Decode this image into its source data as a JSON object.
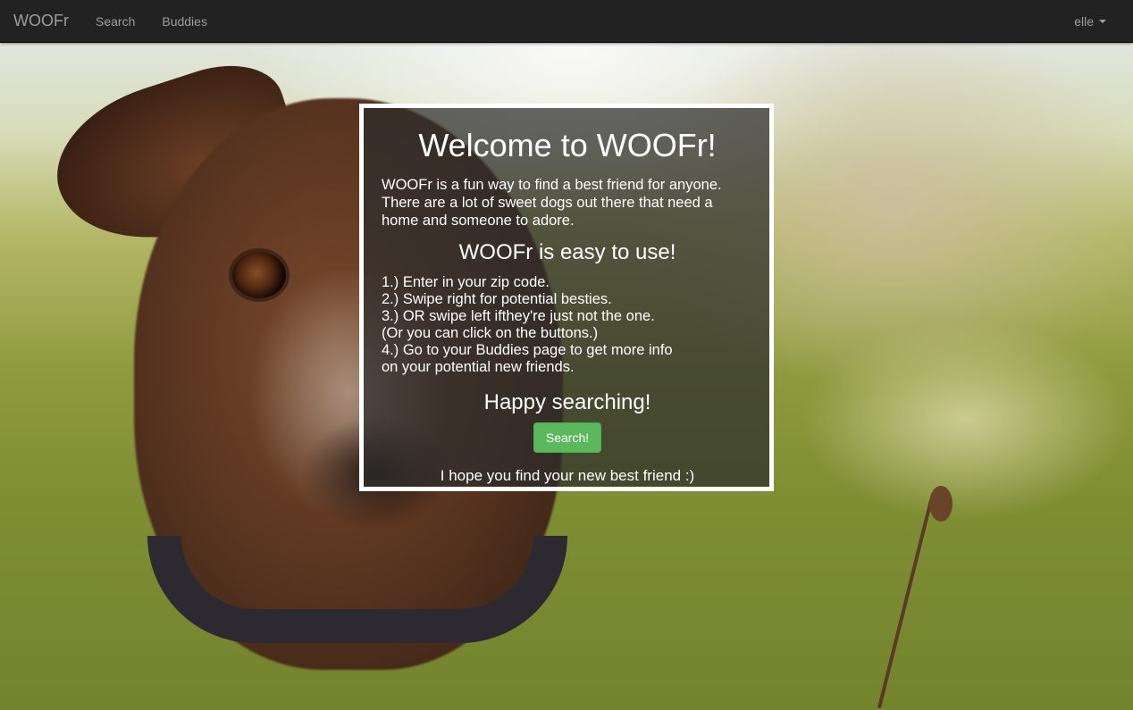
{
  "navbar": {
    "brand": "WOOFr",
    "links": [
      "Search",
      "Buddies"
    ],
    "user": "elle"
  },
  "welcome": {
    "title": "Welcome to WOOFr!",
    "intro": "WOOFr is a fun way to find a best friend for anyone. There are a lot of sweet dogs out there that need a home and someone to adore.",
    "subtitle": "WOOFr is easy to use!",
    "steps": [
      "1.) Enter in your zip code.",
      "2.) Swipe right for potential besties.",
      "3.) OR swipe left ifthey're just not the one.",
      "(Or you can click on the buttons.)",
      "4.) Go to your Buddies page to get more info",
      "on your potential new friends."
    ],
    "happy": "Happy searching!",
    "button_label": "Search!",
    "closing": "I hope you find your new best friend :)"
  },
  "colors": {
    "navbar_bg": "#222222",
    "button_green": "#5cb85c"
  }
}
